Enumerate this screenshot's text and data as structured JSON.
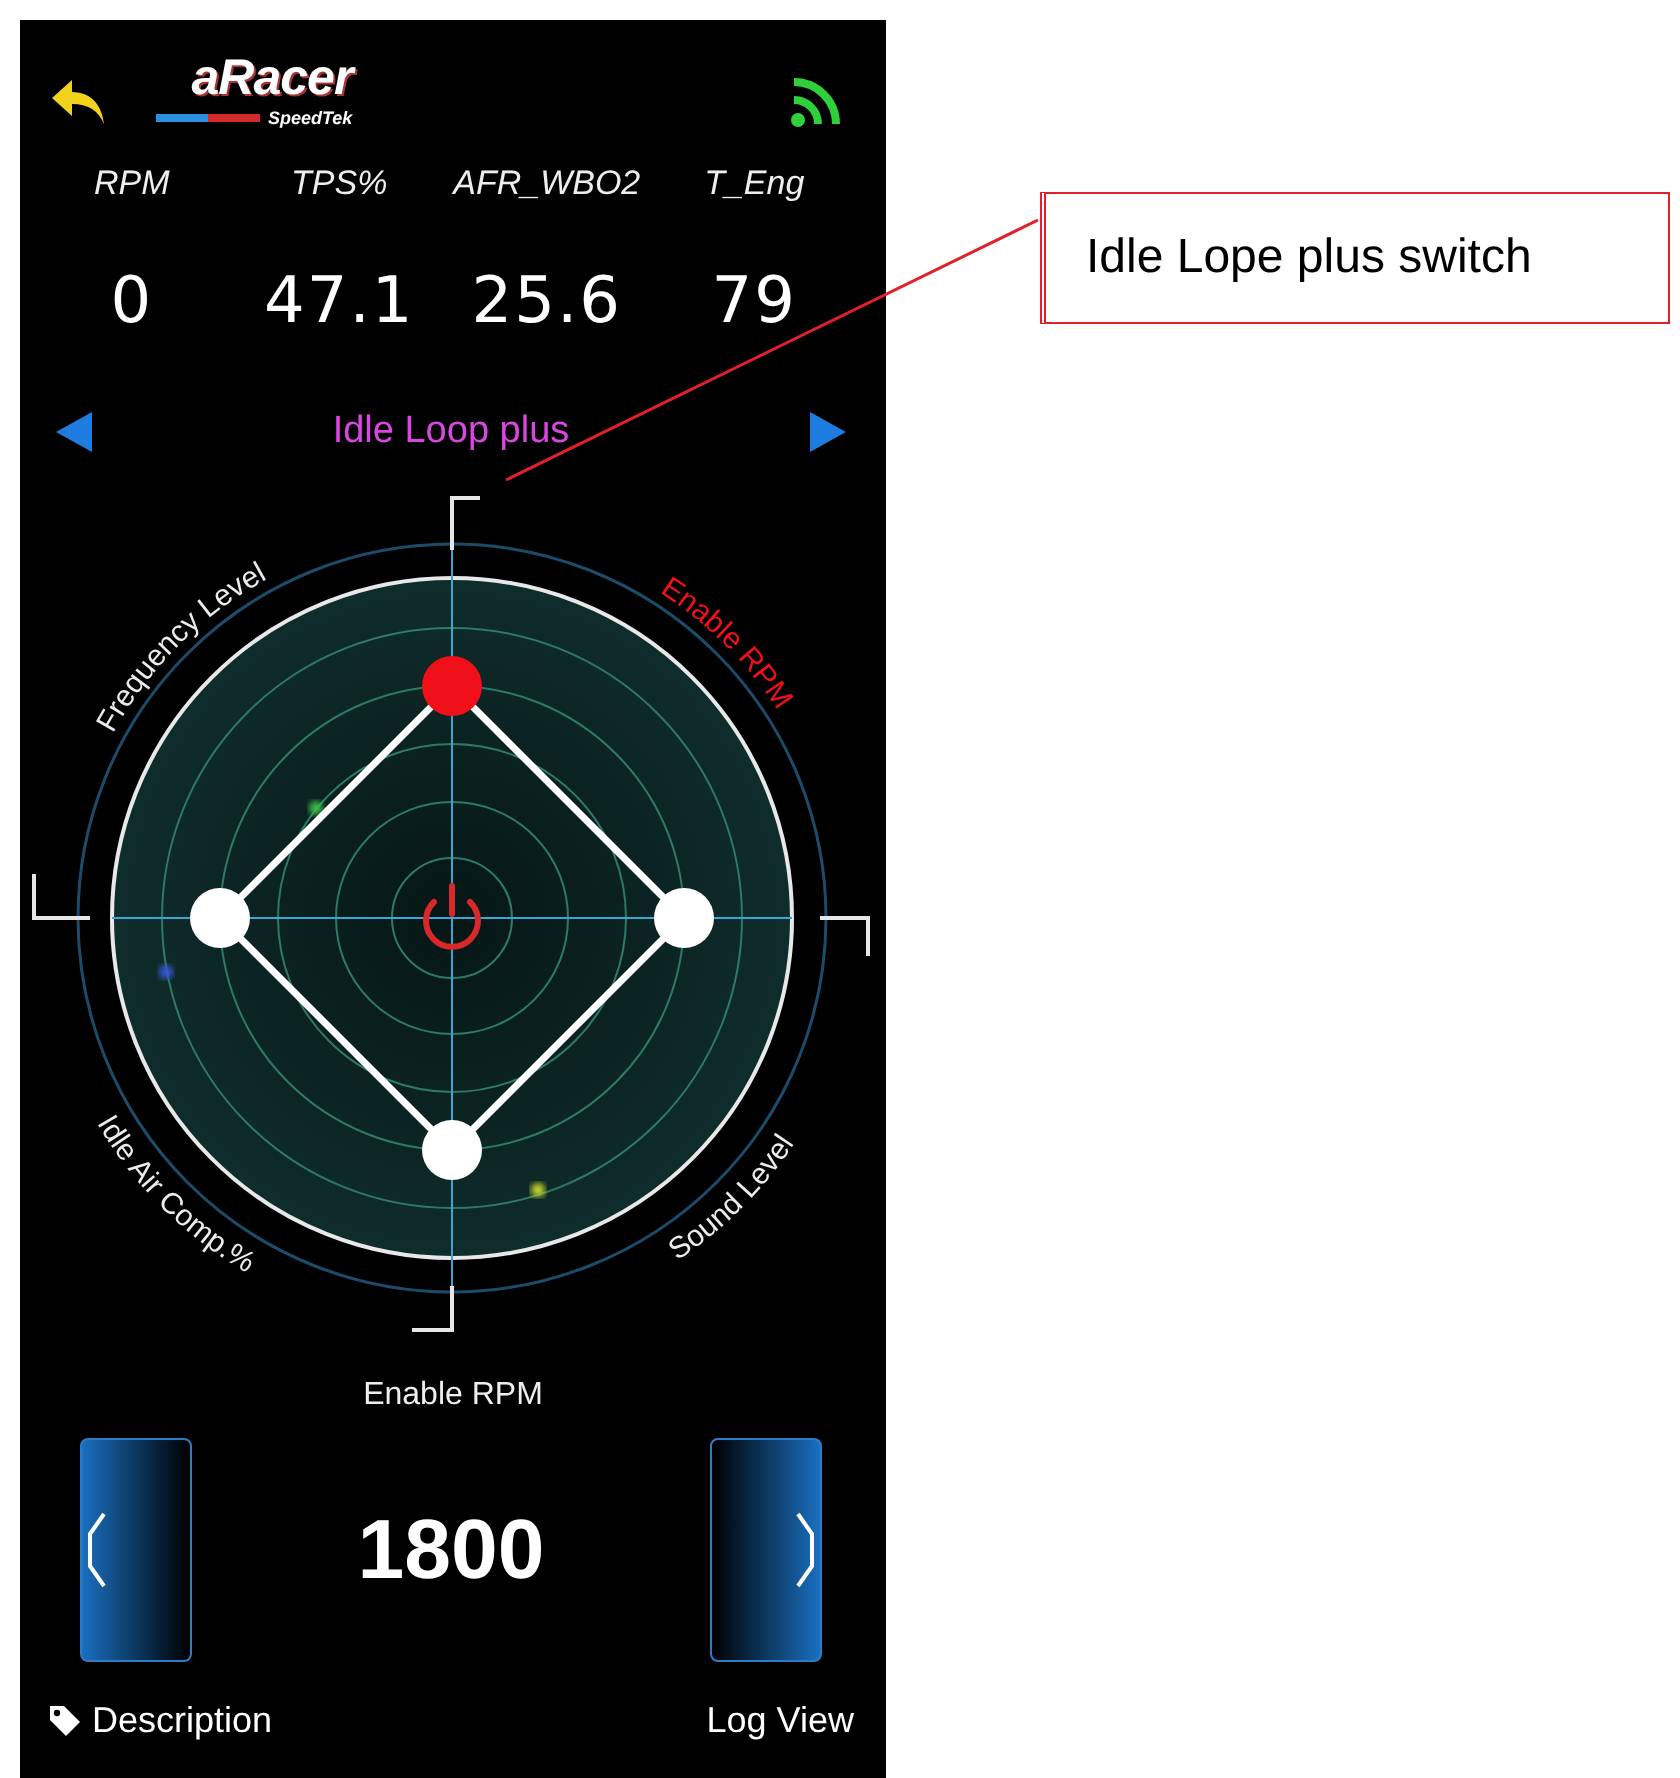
{
  "header": {
    "logo": {
      "title": "aRacer",
      "subtitle": "SpeedTek"
    },
    "connected": true
  },
  "metrics": [
    {
      "label": "RPM",
      "value": "0"
    },
    {
      "label": "TPS%",
      "value": "47.1"
    },
    {
      "label": "AFR_WBO2",
      "value": "25.6"
    },
    {
      "label": "T_Eng",
      "value": "79"
    }
  ],
  "mode_nav": {
    "title": "Idle Loop plus"
  },
  "radar": {
    "axes": [
      {
        "label": "Frequency Level",
        "selected": false
      },
      {
        "label": "Enable RPM",
        "selected": true
      },
      {
        "label": "Idle Air Comp.%",
        "selected": false
      },
      {
        "label": "Sound Level",
        "selected": false
      }
    ]
  },
  "stepper": {
    "label": "Enable RPM",
    "value": "1800"
  },
  "footer": {
    "description": "Description",
    "log_view": "Log View"
  },
  "annotation": {
    "text": "Idle Lope plus switch"
  }
}
